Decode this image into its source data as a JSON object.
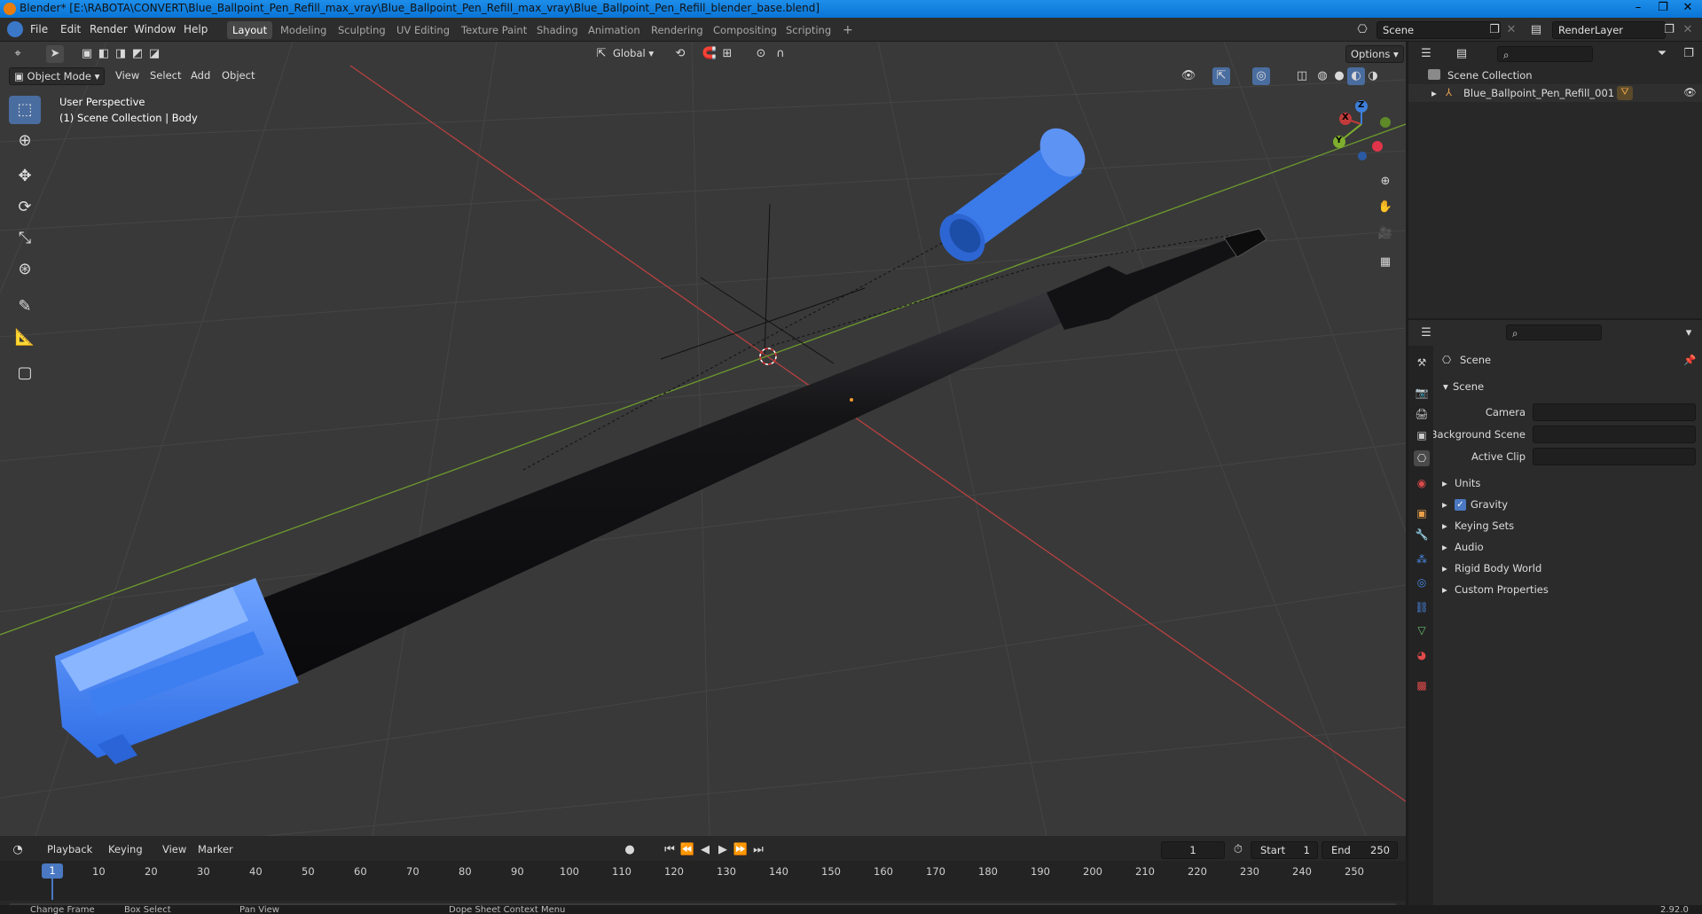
{
  "title_bar": {
    "title": "Blender* [E:\\RABOTA\\CONVERT\\Blue_Ballpoint_Pen_Refill_max_vray\\Blue_Ballpoint_Pen_Refill_max_vray\\Blue_Ballpoint_Pen_Refill_blender_base.blend]"
  },
  "menu": {
    "items": [
      "File",
      "Edit",
      "Render",
      "Window",
      "Help"
    ]
  },
  "workspaces": {
    "tabs": [
      "Layout",
      "Modeling",
      "Sculpting",
      "UV Editing",
      "Texture Paint",
      "Shading",
      "Animation",
      "Rendering",
      "Compositing",
      "Scripting"
    ],
    "add": "+"
  },
  "scene_selector": {
    "value": "Scene"
  },
  "render_layer": {
    "value": "RenderLayer"
  },
  "viewport_header": {
    "orientation": "Global",
    "options": "Options",
    "mode": "Object Mode",
    "menus": [
      "View",
      "Select",
      "Add",
      "Object"
    ]
  },
  "viewport_overlay": {
    "line1": "User Perspective",
    "line2": "(1) Scene Collection | Body"
  },
  "gizmo": {
    "x": "X",
    "y": "Y",
    "z": "Z"
  },
  "outliner": {
    "root": "Scene Collection",
    "items": [
      {
        "label": "Blue_Ballpoint_Pen_Refill_001"
      }
    ]
  },
  "properties": {
    "context": "Scene",
    "panel_title": "Scene",
    "fields": [
      {
        "label": "Camera",
        "value": ""
      },
      {
        "label": "Background Scene",
        "value": ""
      },
      {
        "label": "Active Clip",
        "value": ""
      }
    ],
    "sections": [
      {
        "label": "Units",
        "checkbox": false
      },
      {
        "label": "Gravity",
        "checkbox": true
      },
      {
        "label": "Keying Sets",
        "checkbox": false
      },
      {
        "label": "Audio",
        "checkbox": false
      },
      {
        "label": "Rigid Body World",
        "checkbox": false
      },
      {
        "label": "Custom Properties",
        "checkbox": false
      }
    ]
  },
  "timeline": {
    "menus": [
      "Playback",
      "Keying",
      "View",
      "Marker"
    ],
    "current_frame": "1",
    "start_label": "Start",
    "start": "1",
    "end_label": "End",
    "end": "250",
    "ticks": [
      "10",
      "20",
      "30",
      "40",
      "50",
      "60",
      "70",
      "80",
      "90",
      "100",
      "110",
      "120",
      "130",
      "140",
      "150",
      "160",
      "170",
      "180",
      "190",
      "200",
      "210",
      "220",
      "230",
      "240",
      "250"
    ],
    "frame_marker": "1"
  },
  "status_bar": {
    "items": [
      "Change Frame",
      "Box Select",
      "Pan View",
      "Dope Sheet Context Menu"
    ],
    "version": "2.92.0"
  },
  "colors": {
    "accent_blue": "#4a6da0",
    "pen_cap_blue": "#3a7ae8",
    "x_axis": "#c23a3a",
    "y_axis": "#7fae2e"
  }
}
